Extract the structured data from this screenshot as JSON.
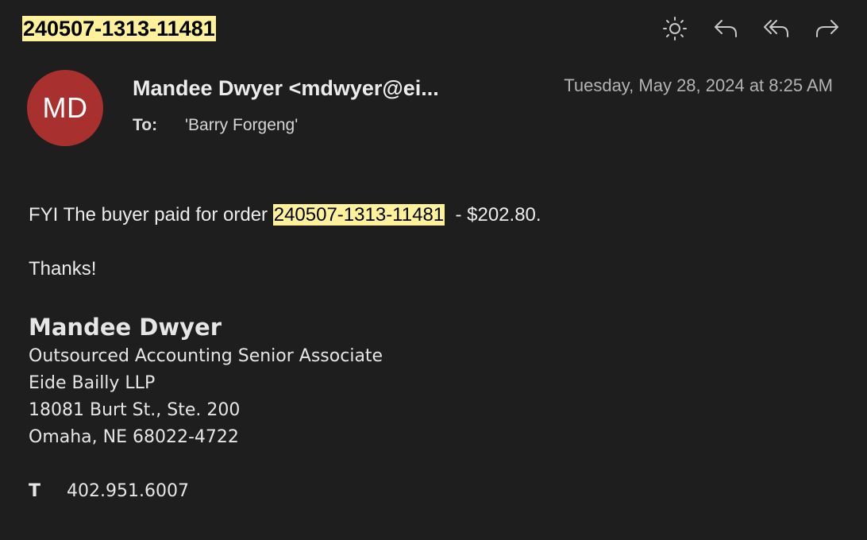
{
  "subject": "240507-1313-11481",
  "toolbar": {
    "buttons": [
      {
        "name": "brightness-button",
        "icon": "sun-icon"
      },
      {
        "name": "reply-button",
        "icon": "reply-icon"
      },
      {
        "name": "reply-all-button",
        "icon": "reply-all-icon"
      },
      {
        "name": "forward-button",
        "icon": "forward-icon"
      }
    ]
  },
  "message": {
    "avatar_initials": "MD",
    "avatar_color": "#a8302f",
    "from": "Mandee Dwyer <mdwyer@ei...",
    "date": "Tuesday, May 28, 2024 at 8:25 AM",
    "to_label": "To:",
    "to_value": "'Barry Forgeng'"
  },
  "body": {
    "line1_prefix": "FYI The buyer paid for order ",
    "line1_highlight": "240507-1313-11481",
    "line1_suffix": "  - $202.80.",
    "thanks": "Thanks!"
  },
  "signature": {
    "name": "Mandee Dwyer",
    "title": "Outsourced Accounting Senior Associate",
    "company": "Eide Bailly LLP",
    "address1": "18081 Burt St., Ste. 200",
    "address2": "Omaha, NE 68022-4722",
    "phone_label": "T",
    "phone": "402.951.6007"
  },
  "colors": {
    "background": "#1e1e1e",
    "highlight": "#fdf29b"
  }
}
